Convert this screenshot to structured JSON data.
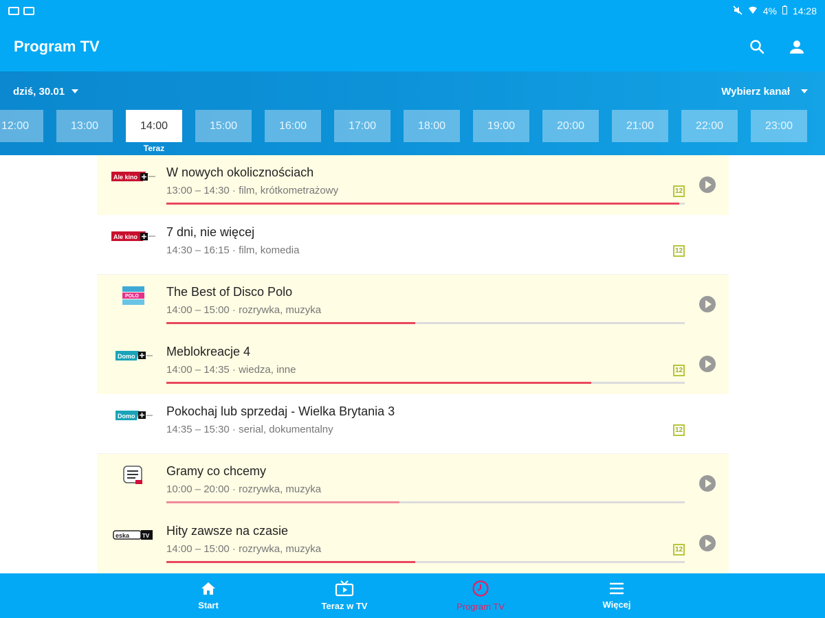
{
  "status": {
    "battery": "4%",
    "time": "14:28"
  },
  "appbar": {
    "title": "Program TV",
    "icons": [
      "search-icon",
      "account-icon"
    ]
  },
  "filters": {
    "date_label": "dziś, 30.01",
    "channel_label": "Wybierz kanał"
  },
  "hours": {
    "labels": [
      "12:00",
      "13:00",
      "14:00",
      "15:00",
      "16:00",
      "17:00",
      "18:00",
      "19:00",
      "20:00",
      "21:00",
      "22:00",
      "23:00"
    ],
    "selected": "14:00",
    "now_label": "Teraz"
  },
  "programs": [
    {
      "channel_icon": "ale-kino-plus-logo",
      "title": "W nowych okolicznościach",
      "meta": "13:00 – 14:30 · film, krótkometrażowy",
      "age": "12",
      "progress": 0.99,
      "live": true
    },
    {
      "channel_icon": "ale-kino-plus-logo",
      "title": "7 dni, nie więcej",
      "meta": "14:30 – 16:15 · film, komedia",
      "age": "12",
      "progress": null,
      "live": false
    },
    {
      "channel_icon": "disco-polo-music-logo",
      "title": "The Best of Disco Polo",
      "meta": "14:00 – 15:00 · rozrywka, muzyka",
      "age": "",
      "progress": 0.48,
      "live": true
    },
    {
      "channel_icon": "domo-plus-logo",
      "title": "Meblokreacje 4",
      "meta": "14:00 – 14:35 · wiedza, inne",
      "age": "12",
      "progress": 0.82,
      "live": true
    },
    {
      "channel_icon": "domo-plus-logo",
      "title": "Pokochaj lub sprzedaj - Wielka Brytania 3",
      "meta": "14:35 – 15:30 · serial, dokumentalny",
      "age": "12",
      "progress": null,
      "live": false
    },
    {
      "channel_icon": "eska-rock-tv-logo",
      "title": "Gramy co chcemy",
      "meta": "10:00 – 20:00 · rozrywka, muzyka",
      "age": "",
      "progress": 0.45,
      "live": true
    },
    {
      "channel_icon": "eska-tv-logo",
      "title": "Hity zawsze na czasie",
      "meta": "14:00 – 15:00 · rozrywka, muzyka",
      "age": "12",
      "progress": 0.48,
      "live": true
    }
  ],
  "bottomnav": {
    "items": [
      {
        "label": "Start",
        "icon": "home-icon",
        "active": false
      },
      {
        "label": "Teraz w TV",
        "icon": "tv-icon",
        "active": false
      },
      {
        "label": "Program TV",
        "icon": "clock-icon",
        "active": true
      },
      {
        "label": "Więcej",
        "icon": "menu-icon",
        "active": false
      }
    ],
    "active_color": "#e91e63"
  },
  "colors": {
    "primary": "#03a9f4",
    "live_row": "#fffde4",
    "progress": "#e9475d",
    "age_badge": "#b7c63a"
  }
}
